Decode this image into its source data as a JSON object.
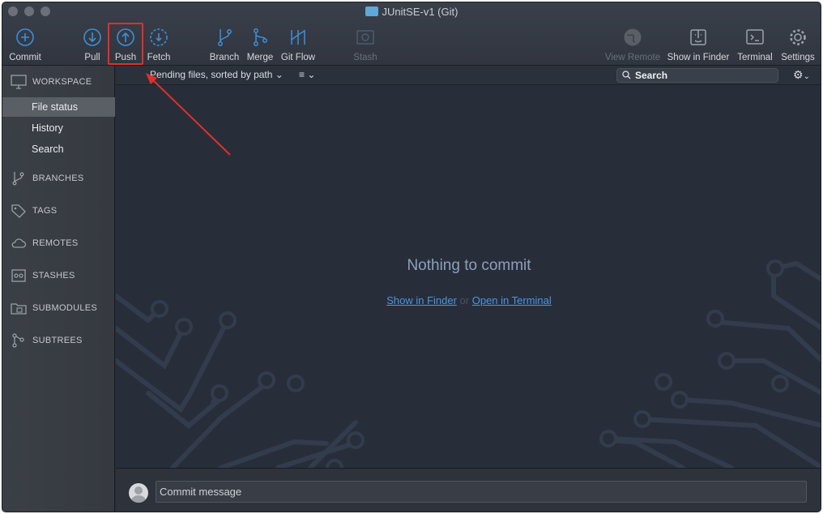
{
  "window": {
    "title": "JUnitSE-v1 (Git)"
  },
  "toolbar": {
    "commit": "Commit",
    "pull": "Pull",
    "push": "Push",
    "fetch": "Fetch",
    "branch": "Branch",
    "merge": "Merge",
    "git_flow": "Git Flow",
    "stash": "Stash",
    "view_remote": "View Remote",
    "show_in_finder": "Show in Finder",
    "terminal": "Terminal",
    "settings": "Settings"
  },
  "sidebar": {
    "workspace": "WORKSPACE",
    "items": [
      "File status",
      "History",
      "Search"
    ],
    "sections": [
      "BRANCHES",
      "TAGS",
      "REMOTES",
      "STASHES",
      "SUBMODULES",
      "SUBTREES"
    ]
  },
  "filterbar": {
    "sort": "Pending files, sorted by path",
    "search_placeholder": "Search"
  },
  "main": {
    "empty_title": "Nothing to commit",
    "link_finder": "Show in Finder",
    "or": "or",
    "link_terminal": "Open in Terminal"
  },
  "commit": {
    "placeholder": "Commit message"
  },
  "colors": {
    "accent": "#3d8fd6",
    "highlight": "#e0302a",
    "link": "#4a95e6"
  }
}
